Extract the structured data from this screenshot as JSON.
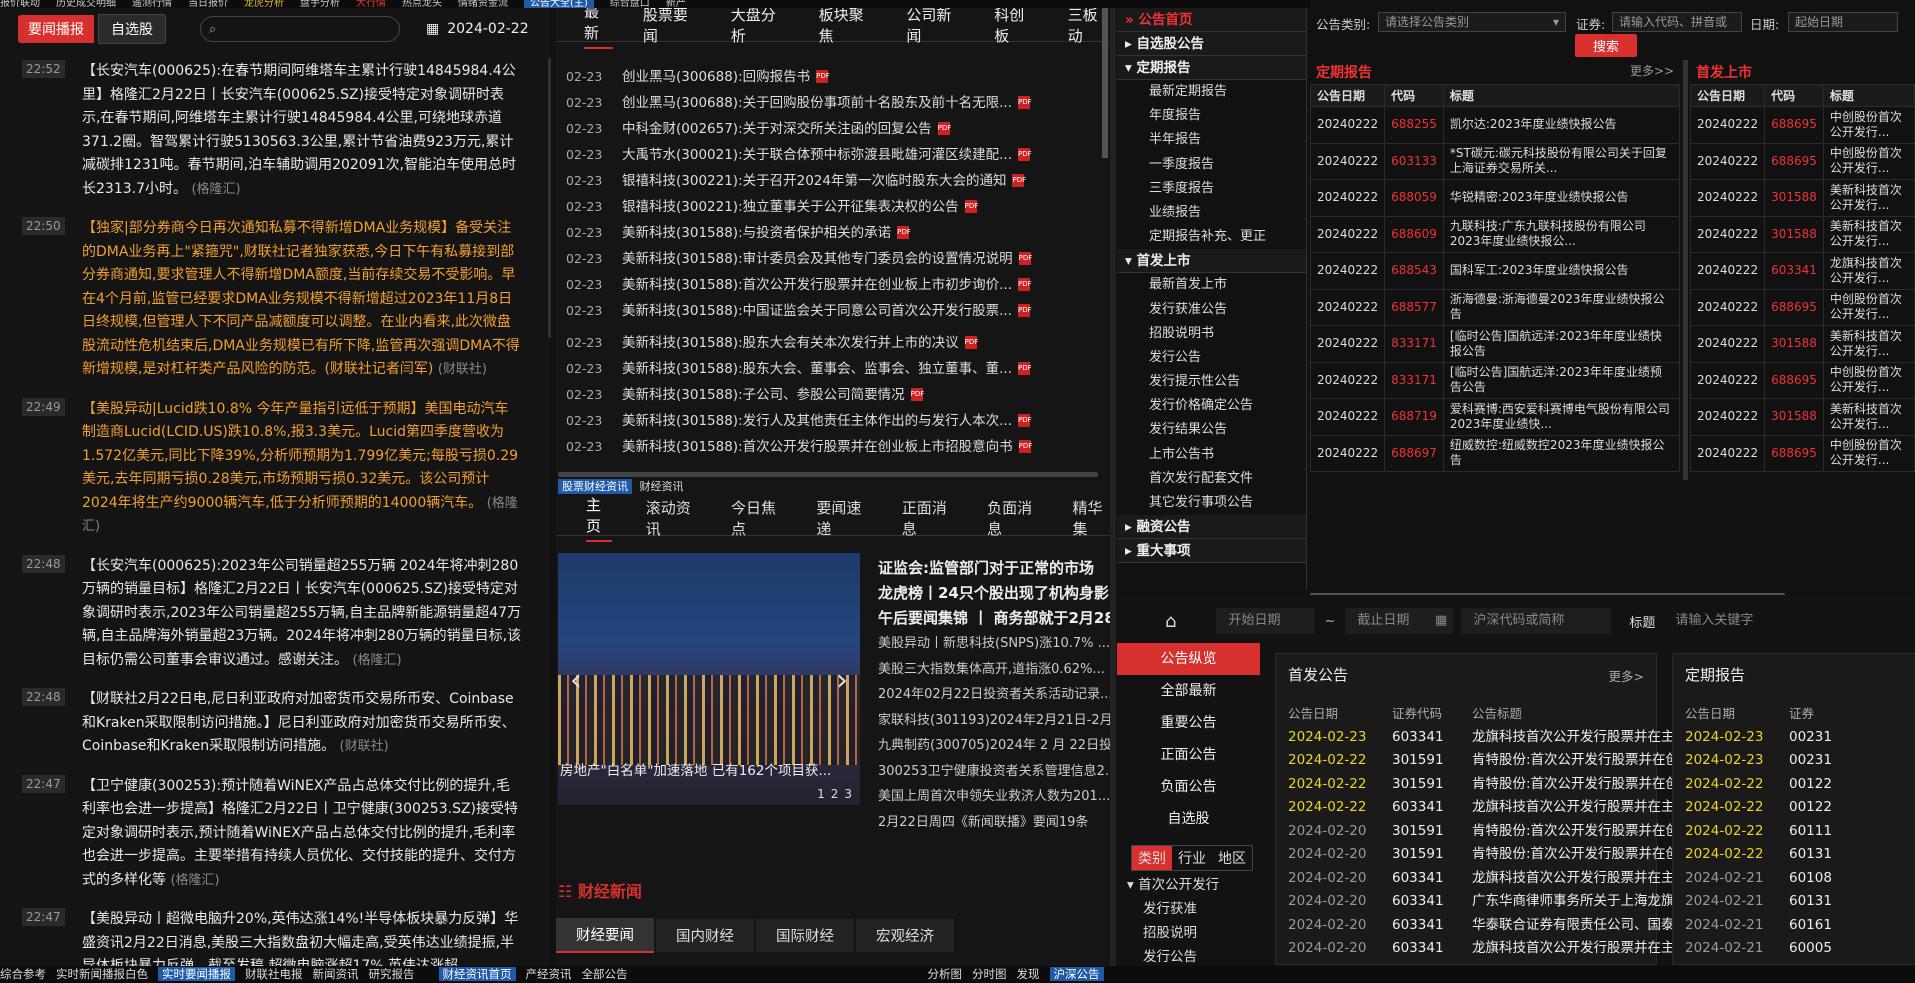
{
  "topbar": {
    "items": [
      "报价联动",
      "历史成交明细",
      "遥测行情",
      "当日报价",
      "龙虎分析",
      "盘手分析",
      "大行情",
      "热点龙头",
      "情绪资金流",
      "综合盘口",
      "新产"
    ],
    "active": "公告大全(主)"
  },
  "left": {
    "tab_news": "要闻播报",
    "tab_watch": "自选股",
    "search_placeholder": "",
    "date": "2024-02-22",
    "items": [
      {
        "time": "22:52",
        "color": "wh",
        "text": "【长安汽车(000625):在春节期间阿维塔车主累计行驶14845984.4公里】格隆汇2月22日丨长安汽车(000625.SZ)接受特定对象调研时表示,在春节期间,阿维塔车主累计行驶14845984.4公里,可绕地球赤道371.2圈。智驾累计行驶5130563.3公里,累计节省油费923万元,累计减碳排1231吨。春节期间,泊车辅助调用202091次,智能泊车使用总时长2313.7小时。",
        "src": "(格隆汇)"
      },
      {
        "time": "22:50",
        "color": "or",
        "text": "【独家|部分券商今日再次通知私募不得新增DMA业务规模】备受关注的DMA业务再上\"紧箍咒\",财联社记者独家获悉,今日下午有私募接到部分券商通知,要求管理人不得新增DMA额度,当前存续交易不受影响。早在4个月前,监管已经要求DMA业务规模不得新增超过2023年11月8日日终规模,但管理人下不同产品减额度可以调整。在业内看来,此次微盘股流动性危机结束后,DMA业务规模已有所下降,监管再次强调DMA不得新增规模,是对杠杆类产品风险的防范。(财联社记者闫军)",
        "src": "(财联社)"
      },
      {
        "time": "22:49",
        "color": "or",
        "text": "【美股异动|Lucid跌10.8% 今年产量指引远低于预期】美国电动汽车制造商Lucid(LCID.US)跌10.8%,报3.3美元。Lucid第四季度营收为1.572亿美元,同比下降39%,分析师预期为1.799亿美元;每股亏损0.29美元,去年同期亏损0.28美元,市场预期亏损0.32美元。该公司预计2024年将生产约9000辆汽车,低于分析师预期的14000辆汽车。",
        "src": "(格隆汇)"
      },
      {
        "time": "22:48",
        "color": "wh",
        "text": "【长安汽车(000625):2023年公司销量超255万辆 2024年将冲刺280万辆的销量目标】格隆汇2月22日丨长安汽车(000625.SZ)接受特定对象调研时表示,2023年公司销量超255万辆,自主品牌新能源销量超47万辆,自主品牌海外销量超23万辆。2024年将冲刺280万辆的销量目标,该目标仍需公司董事会审议通过。感谢关注。",
        "src": "(格隆汇)"
      },
      {
        "time": "22:48",
        "color": "wh",
        "text": "【财联社2月22日电,尼日利亚政府对加密货币交易所币安、Coinbase和Kraken采取限制访问措施。】尼日利亚政府对加密货币交易所币安、Coinbase和Kraken采取限制访问措施。",
        "src": "(财联社)"
      },
      {
        "time": "22:47",
        "color": "wh",
        "text": "【卫宁健康(300253):预计随着WiNEX产品占总体交付比例的提升,毛利率也会进一步提高】格隆汇2月22日丨卫宁健康(300253.SZ)接受特定对象调研时表示,预计随着WiNEX产品占总体交付比例的提升,毛利率也会进一步提高。主要举措有持续人员优化、交付技能的提升、交付方式的多样化等",
        "src": "(格隆汇)"
      },
      {
        "time": "22:47",
        "color": "wh",
        "text": "【美股异动丨超微电脑升20%,英伟达涨14%!半导体板块暴力反弹】华盛资讯2月22日消息,美股三大指数盘初大幅走高,受英伟达业绩提振,半导体板块暴力反弹。截至发稿,超微电脑涨超17%,英伟达涨超20%,$ARM涨超",
        "src": ""
      }
    ]
  },
  "mid": {
    "tabs": [
      "最新",
      "股票要闻",
      "大盘分析",
      "板块聚焦",
      "公司新闻",
      "科创板",
      "三板动"
    ],
    "anns": [
      {
        "d": "02-23",
        "t": "创业黑马(300688):回购报告书"
      },
      {
        "d": "02-23",
        "t": "创业黑马(300688):关于回购股份事项前十名股东及前十名无限..."
      },
      {
        "d": "02-23",
        "t": "中科金财(002657):关于对深交所关注函的回复公告"
      },
      {
        "d": "02-23",
        "t": "大禹节水(300021):关于联合体预中标弥渡县毗雄河灌区续建配..."
      },
      {
        "d": "02-23",
        "t": "银禧科技(300221):关于召开2024年第一次临时股东大会的通知"
      },
      {
        "d": "02-23",
        "t": "银禧科技(300221):独立董事关于公开征集表决权的公告"
      },
      {
        "d": "02-23",
        "t": "美新科技(301588):与投资者保护相关的承诺"
      },
      {
        "d": "02-23",
        "t": "美新科技(301588):审计委员会及其他专门委员会的设置情况说明"
      },
      {
        "d": "02-23",
        "t": "美新科技(301588):首次公开发行股票并在创业板上市初步询价..."
      },
      {
        "d": "02-23",
        "t": "美新科技(301588):中国证监会关于同意公司首次公开发行股票..."
      },
      {
        "d": "02-23",
        "t": "美新科技(301588):股东大会有关本次发行并上市的决议"
      },
      {
        "d": "02-23",
        "t": "美新科技(301588):股东大会、董事会、监事会、独立董事、董..."
      },
      {
        "d": "02-23",
        "t": "美新科技(301588):子公司、参股公司简要情况"
      },
      {
        "d": "02-23",
        "t": "美新科技(301588):发行人及其他责任主体作出的与发行人本次..."
      },
      {
        "d": "02-23",
        "t": "美新科技(301588):首次公开发行股票并在创业板上市招股意向书"
      }
    ],
    "label_a": "股票财经资讯",
    "label_b": "财经资讯",
    "ntabs": [
      "主页",
      "滚动资讯",
      "今日焦点",
      "要闻速递",
      "正面消息",
      "负面消息",
      "精华集"
    ],
    "photo_caption": "房地产\"白名单\"加速落地 已有162个项目获...",
    "dots": [
      "1",
      "2",
      "3"
    ],
    "heads": [
      "证监会:监管部门对于正常的市场",
      "龙虎榜丨24只个股出现了机构身影",
      "午后要闻集锦 丨 商务部就于2月28"
    ],
    "news": [
      "美股异动丨新思科技(SNPS)涨10.7% ...",
      "美股三大指数集体高开,道指涨0.62%...",
      "2024年02月22日投资者关系活动记录...",
      "家联科技(301193)2024年2月21日-2月...",
      "九典制药(300705)2024年 2 月 22日投...",
      "300253卫宁健康投资者关系管理信息2...",
      "美国上周首次申领失业救济人数为201...",
      "2月22日周四《新闻联播》要闻19条"
    ],
    "fin_title": "财经新闻",
    "ftabs": [
      "财经要闻",
      "国内财经",
      "国际财经",
      "宏观经济"
    ]
  },
  "nav": {
    "groups": [
      {
        "label": "公告首页",
        "red": true,
        "items": []
      },
      {
        "label": "自选股公告",
        "red": false,
        "items": []
      },
      {
        "label": "定期报告",
        "red": false,
        "items": [
          "最新定期报告",
          "年度报告",
          "半年报告",
          "一季度报告",
          "三季度报告",
          "业绩报告",
          "定期报告补充、更正"
        ]
      },
      {
        "label": "首发上市",
        "red": false,
        "items": [
          "最新首发上市",
          "发行获准公告",
          "招股说明书",
          "发行公告",
          "发行提示性公告",
          "发行价格确定公告",
          "发行结果公告",
          "上市公告书",
          "首次发行配套文件",
          "其它发行事项公告"
        ]
      },
      {
        "label": "融资公告",
        "red": false,
        "items": []
      },
      {
        "label": "重大事项",
        "red": false,
        "items": []
      }
    ]
  },
  "filter": {
    "type_label": "公告类别:",
    "type_ph": "请选择公告类别",
    "sec_label": "证券:",
    "sec_ph": "请输入代码、拼音或",
    "date_label": "日期:",
    "date_ph": "起始日期",
    "search": "搜索"
  },
  "t1": {
    "title": "定期报告",
    "more": "更多>>",
    "cols": [
      "公告日期",
      "代码",
      "标题"
    ],
    "rows": [
      [
        "20240222",
        "688255",
        "凯尔达:2023年度业绩快报公告"
      ],
      [
        "20240222",
        "603133",
        "*ST碳元:碳元科技股份有限公司关于回复上海证券交易所关..."
      ],
      [
        "20240222",
        "688059",
        "华锐精密:2023年度业绩快报公告"
      ],
      [
        "20240222",
        "688609",
        "九联科技:广东九联科技股份有限公司2023年度业绩快报公..."
      ],
      [
        "20240222",
        "688543",
        "国科军工:2023年度业绩快报公告"
      ],
      [
        "20240222",
        "688577",
        "浙海德曼:浙海德曼2023年度业绩快报公告"
      ],
      [
        "20240222",
        "833171",
        "[临时公告]国航远洋:2023年年度业绩快报公告"
      ],
      [
        "20240222",
        "833171",
        "[临时公告]国航远洋:2023年年度业绩预告公告"
      ],
      [
        "20240222",
        "688719",
        "爱科赛博:西安爱科赛博电气股份有限公司2023年度业绩快..."
      ],
      [
        "20240222",
        "688697",
        "纽威数控:纽威数控2023年度业绩快报公告"
      ]
    ]
  },
  "t2": {
    "title": "首发上市",
    "cols": [
      "公告日期",
      "代码",
      "标题"
    ],
    "rows": [
      [
        "20240222",
        "688695",
        "中创股份首次公开发行..."
      ],
      [
        "20240222",
        "688695",
        "中创股份首次公开发行..."
      ],
      [
        "20240222",
        "301588",
        "美新科技首次公开发行..."
      ],
      [
        "20240222",
        "301588",
        "美新科技首次公开发行..."
      ],
      [
        "20240222",
        "603341",
        "龙旗科技首次公开发行..."
      ],
      [
        "20240222",
        "688695",
        "中创股份首次公开发行..."
      ],
      [
        "20240222",
        "301588",
        "美新科技首次公开发行..."
      ],
      [
        "20240222",
        "688695",
        "中创股份首次公开发行..."
      ],
      [
        "20240222",
        "301588",
        "美新科技首次公开发行..."
      ],
      [
        "20240222",
        "688695",
        "中创股份首次公开发行..."
      ]
    ]
  },
  "br": {
    "start_ph": "开始日期",
    "tilde": "~",
    "end_ph": "截止日期",
    "code_ph": "沪深代码或简称",
    "title_label": "标题",
    "kw_ph": "请输入关键字",
    "side": [
      "公告纵览",
      "全部最新",
      "重要公告",
      "正面公告",
      "负面公告",
      "自选股"
    ],
    "seg": [
      "类别",
      "行业",
      "地区"
    ],
    "tree_head": "首次公开发行",
    "tree": [
      "发行获准",
      "招股说明",
      "发行公告"
    ],
    "card1": {
      "title": "首发公告",
      "more": "更多>",
      "cols": [
        "公告日期",
        "证券代码",
        "公告标题"
      ],
      "rows": [
        [
          "2024-02-23",
          "603341",
          "龙旗科技首次公开发行股票并在主板...",
          "ylw"
        ],
        [
          "2024-02-22",
          "301591",
          "肯特股份:首次公开发行股票并在创...",
          "ylw"
        ],
        [
          "2024-02-22",
          "301591",
          "肯特股份:首次公开发行股票并在创...",
          "ylw"
        ],
        [
          "2024-02-22",
          "603341",
          "龙旗科技首次公开发行股票并在主板...",
          "ylw"
        ],
        [
          "2024-02-20",
          "301591",
          "肯特股份:首次公开发行股票并在创...",
          "gry"
        ],
        [
          "2024-02-20",
          "301591",
          "肯特股份:首次公开发行股票并在创...",
          "gry"
        ],
        [
          "2024-02-20",
          "603341",
          "龙旗科技首次公开发行股票并在主板...",
          "gry"
        ],
        [
          "2024-02-20",
          "603341",
          "广东华商律师事务所关于上海龙旗科...",
          "gry"
        ],
        [
          "2024-02-20",
          "603341",
          "华泰联合证券有限责任公司、国泰君...",
          "gry"
        ],
        [
          "2024-02-20",
          "603341",
          "龙旗科技首次公开发行股票并在主板...",
          "gry"
        ]
      ]
    },
    "card2": {
      "title": "定期报告",
      "cols": [
        "公告日期",
        "证券"
      ],
      "rows": [
        [
          "2024-02-23",
          "00231",
          "ylw"
        ],
        [
          "2024-02-23",
          "00231",
          "ylw"
        ],
        [
          "2024-02-22",
          "00122",
          "ylw"
        ],
        [
          "2024-02-22",
          "00122",
          "ylw"
        ],
        [
          "2024-02-22",
          "60111",
          "ylw"
        ],
        [
          "2024-02-22",
          "60131",
          "ylw"
        ],
        [
          "2024-02-21",
          "60108",
          "gry"
        ],
        [
          "2024-02-21",
          "60131",
          "gry"
        ],
        [
          "2024-02-21",
          "60161",
          "gry"
        ],
        [
          "2024-02-21",
          "60005",
          "gry"
        ]
      ]
    }
  },
  "status": {
    "left": [
      "综合参考",
      "实时新闻播报白色"
    ],
    "left_act": "实时要闻播报",
    "left2": [
      "财联社电报",
      "新闻资讯",
      "研究报告"
    ],
    "mid_act": "财经资讯首页",
    "mid": [
      "产经资讯",
      "全部公告"
    ],
    "right": [
      "分析图",
      "分时图",
      "发现"
    ],
    "right_act": "沪深公告"
  }
}
